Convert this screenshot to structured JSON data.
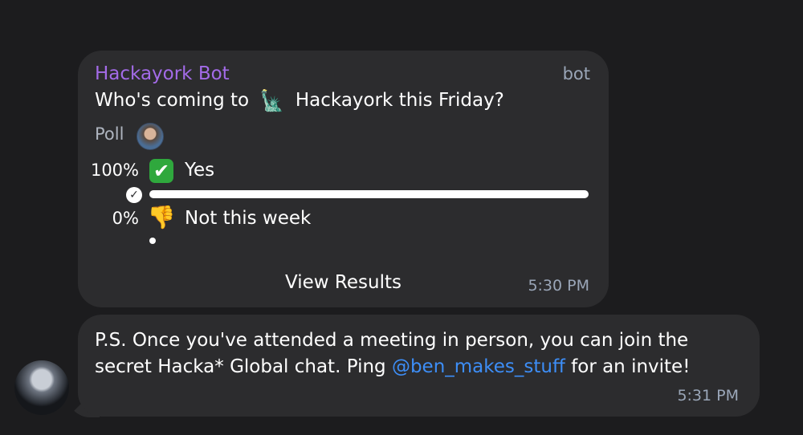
{
  "poll": {
    "sender": "Hackayork Bot",
    "tag": "bot",
    "question_before": "Who's coming to",
    "question_emoji": "🗽",
    "question_after": "Hackayork this Friday?",
    "label": "Poll",
    "options": [
      {
        "percent": "100%",
        "emoji": "✔",
        "text": "Yes",
        "fraction": 1.0,
        "chosen": true
      },
      {
        "percent": "0%",
        "emoji": "👎",
        "text": "Not this week",
        "fraction": 0.0,
        "chosen": false
      }
    ],
    "view_results_label": "View Results",
    "time": "5:30 PM"
  },
  "message": {
    "text_before": "P.S. Once you've attended a meeting in person, you can join the secret Hacka* Global chat. Ping ",
    "mention": "@ben_makes_stuff",
    "text_after": " for an invite!",
    "time": "5:31 PM"
  },
  "colors": {
    "background": "#1c1c1e",
    "bubble": "#2c2c2e",
    "sender_name": "#a36be8",
    "meta": "#9aa6b8",
    "link": "#3d8ef7"
  }
}
